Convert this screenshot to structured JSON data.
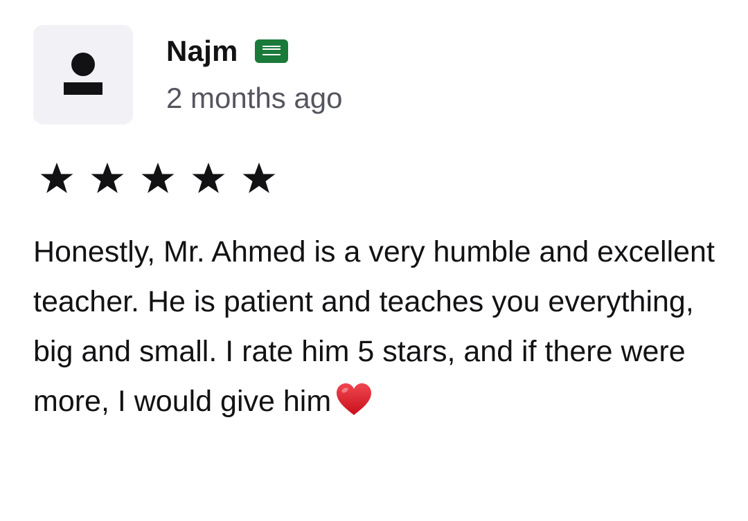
{
  "review": {
    "reviewer_name": "Najm",
    "country_flag_icon": "saudi-arabia-flag-icon",
    "timestamp": "2 months ago",
    "rating": 5,
    "rating_max": 5,
    "text": "Honestly, Mr. Ahmed is a very humble and excellent teacher. He is patient and teaches you everything, big and small. I rate him 5 stars, and if there were more, I would give him",
    "trailing_emoji": "red-heart-icon"
  },
  "colors": {
    "avatar_bg": "#f2f2f6",
    "text_primary": "#121214",
    "text_secondary": "#55555f",
    "flag_green": "#1a7a3a",
    "heart_red": "#e0202e"
  }
}
